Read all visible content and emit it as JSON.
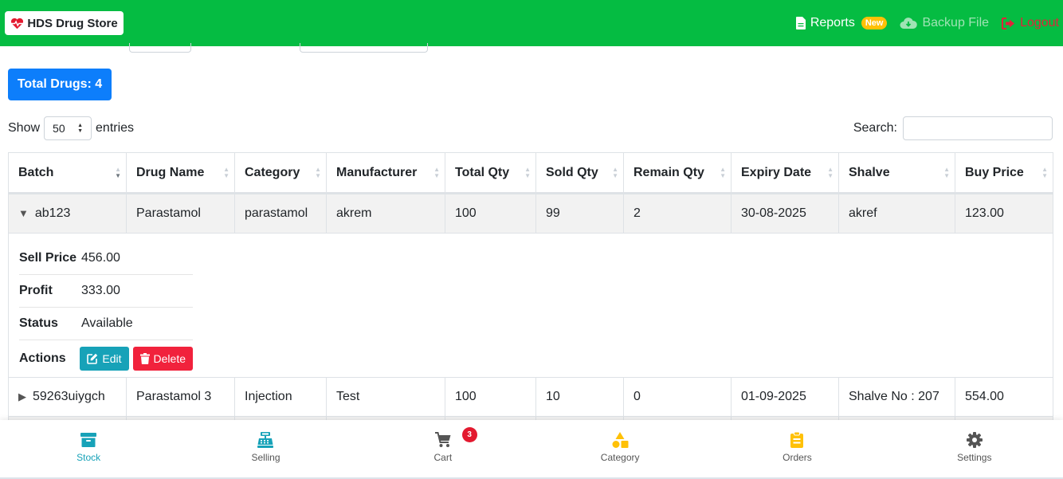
{
  "brand": {
    "name": "HDS Drug Store"
  },
  "nav": {
    "reports": "Reports",
    "new_badge": "New",
    "backup": "Backup File",
    "logout": "Logout"
  },
  "total_drugs": "Total Drugs: 4",
  "length": {
    "show": "Show",
    "value": "50",
    "entries": "entries"
  },
  "search": {
    "label": "Search:",
    "value": ""
  },
  "table": {
    "columns": [
      "Batch",
      "Drug Name",
      "Category",
      "Manufacturer",
      "Total Qty",
      "Sold Qty",
      "Remain Qty",
      "Expiry Date",
      "Shalve",
      "Buy Price"
    ],
    "rows": [
      [
        "ab123",
        "Parastamol",
        "parastamol",
        "akrem",
        "100",
        "99",
        "2",
        "30-08-2025",
        "akref",
        "123.00"
      ],
      [
        "59263uiygch",
        "Parastamol 3",
        "Injection",
        "Test",
        "100",
        "10",
        "0",
        "01-09-2025",
        "Shalve No : 207",
        "554.00"
      ]
    ],
    "expanded_details": {
      "sell_price_label": "Sell Price",
      "sell_price": "456.00",
      "profit_label": "Profit",
      "profit": "333.00",
      "status_label": "Status",
      "status": "Available",
      "actions_label": "Actions",
      "edit": "Edit",
      "delete": "Delete"
    }
  },
  "bottom_nav": {
    "items": [
      "Stock",
      "Selling",
      "Cart",
      "Category",
      "Orders",
      "Settings"
    ],
    "cart_count": "3"
  },
  "colors": {
    "topbar": "#05bc42",
    "primary": "#0d7efb",
    "info": "#17a2b8",
    "danger": "#f1223c",
    "warning": "#ffc107"
  }
}
